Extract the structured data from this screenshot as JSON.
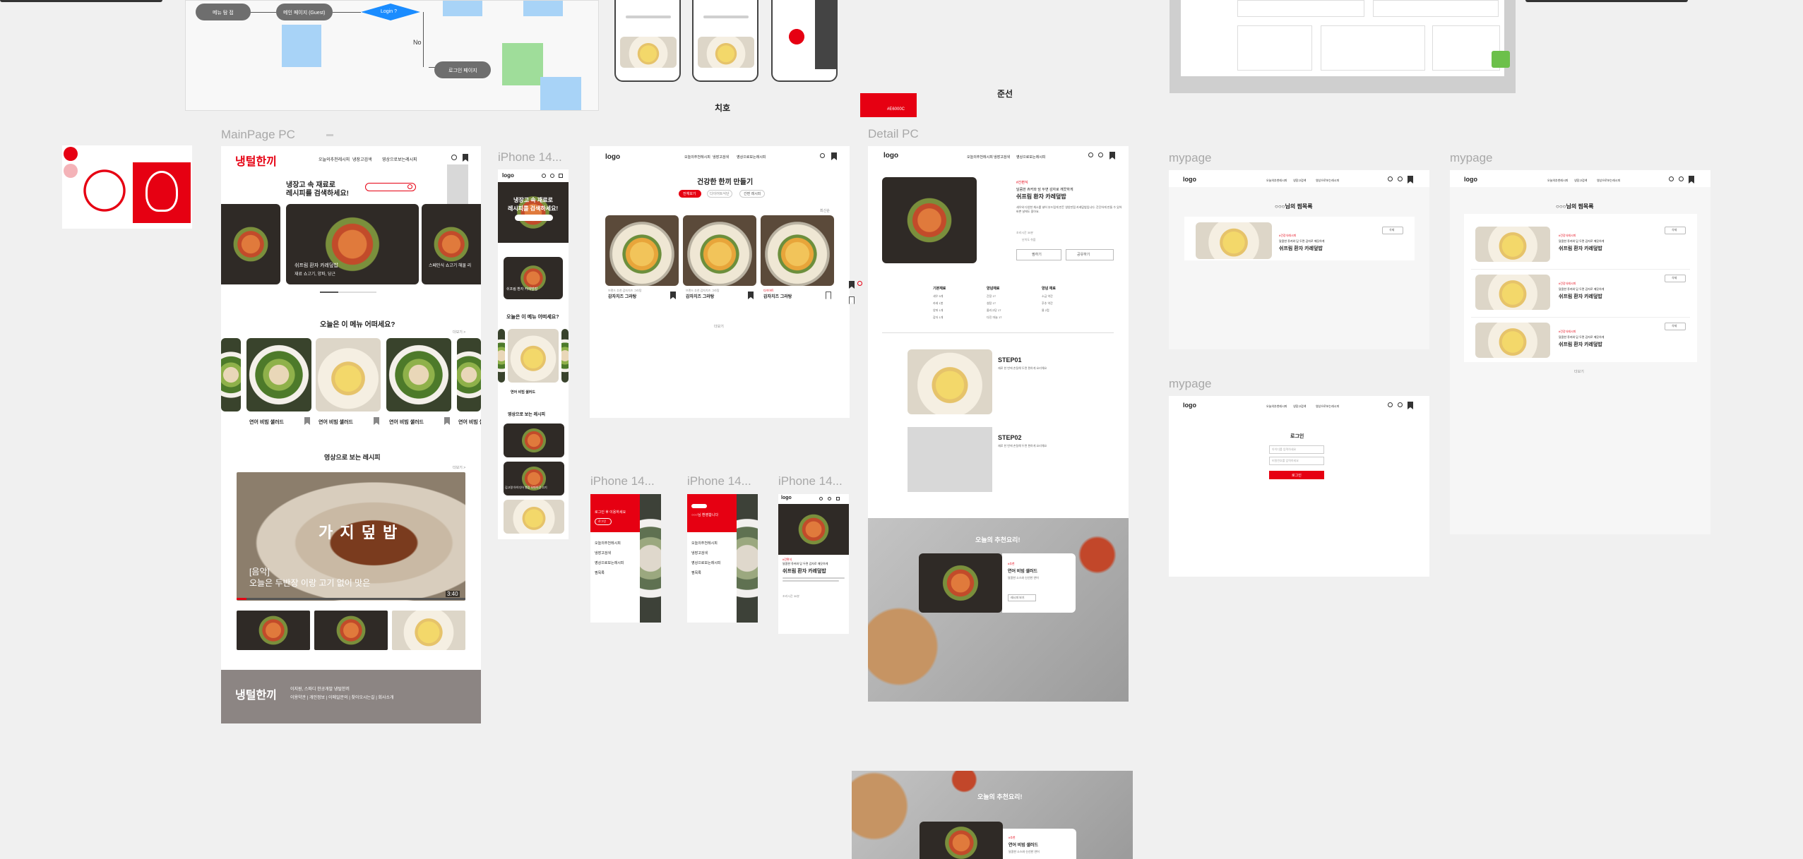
{
  "frame_labels": {
    "main_pc": "MainPage PC",
    "iphone_main": "iPhone 14...",
    "detail_pc": "Detail PC",
    "mypage1": "mypage",
    "mypage2": "mypage",
    "mypage3": "mypage",
    "iphone_a": "iPhone 14...",
    "iphone_b": "iPhone 14...",
    "iphone_c": "iPhone 14..."
  },
  "flow": {
    "node1": "메뉴 탐 접",
    "node2": "메인 페이지 (Guest)",
    "decision": "Login ?",
    "no_label": "No",
    "login_node": "로그인 페이지"
  },
  "captions": {
    "chiho": "치호",
    "junseon": "준선",
    "red_swatch": "#E6000C"
  },
  "colors": {
    "accent": "#e60012",
    "footer": "#8c8583",
    "flow_blue": "#1a8cff",
    "sticky_blue": "#a8d3f7",
    "sticky_green": "#9fdd9a",
    "green_badge": "#6cc04a"
  },
  "main_pc": {
    "nav": [
      "오늘의추천레시피",
      "냉장고검색",
      "영상으로보는레시피"
    ],
    "hero_title_1": "냉장고 속 재료로",
    "hero_title_2": "레시피를 검색하세요!",
    "hero_card_title": "쉬프림 환자 카레덮밥",
    "hero_card_sub": "재료 쇼고기, 양파, 당근",
    "hero_card_right": "스페인식 쇼고기 해물 리",
    "section_today": "오늘은 이 메뉴 어떠세요?",
    "more": "더보기 >",
    "today_items": [
      "연어 비빔 샐러드",
      "연어 비빔 샐러드",
      "연어 비빔 샐러드",
      "연어 비빔 샐"
    ],
    "section_video": "영상으로 보는 레시피",
    "video_overlay": "가 지 덮 밥",
    "video_caption_1": "[음악]",
    "video_caption_2": "오늘은 두반장 이랑 고기 없이 맛은",
    "video_time": "3:40",
    "footer_text": "이지원, 스파디 한공개발 냉털한끼",
    "footer_links": "이용약관 | 개인정보 | 이메일문의 | 찾아오시는길 | 회사소개",
    "logo_text": "냉털한끼"
  },
  "iphone_main": {
    "logo": "logo",
    "hero_1": "냉장고 속 재료로",
    "hero_2": "레시피를 검색하세요!",
    "card_title": "쉬프림 환자 카레덮밥",
    "section_today": "오늘은 이 메뉴 어떠세요?",
    "today_item": "연어 비빔 샐러드",
    "section_video": "영상으로 보는 레시피",
    "video_cap": "김고명 아이디어 볶음 오마이갓 고기"
  },
  "list_pc": {
    "logo": "logo",
    "nav": [
      "오늘의추천레시피",
      "냉장고검색",
      "영상으로보는레시피"
    ],
    "title": "건강한 한끼 만들기",
    "chips": [
      "전체보기",
      "다이어트식단",
      "간편 레시피"
    ],
    "cards": [
      {
        "label": "브랜드 추천 감자치즈 그라탕",
        "title": "감자치즈 그라탕"
      },
      {
        "label": "브랜드 추천 감자치즈 그라탕",
        "title": "감자치즈 그라탕"
      },
      {
        "label": "다이어트",
        "title": "감자치즈 그라탕"
      }
    ],
    "sort": "최신순",
    "more": "더보기"
  },
  "detail_pc": {
    "logo": "logo",
    "nav": [
      "오늘의추천레시피",
      "냉장고검색",
      "영상으로보는레시피"
    ],
    "badge": "#간편식",
    "desc": "달콤한 쥬커와 담 두면 감자로 깨끗하게",
    "title": "쉬프림 환자 카레덮밥",
    "paragraph": "새우와 다양한 채소를 넣어 부드럽게 만든 영양만점 카레덮밥입니다. 간단하게 만들 수 있어 바쁜 날에도 좋아요.",
    "meta1": "조리시간 30분",
    "meta2": "난이도 쉬움",
    "btn_left": "찜하기",
    "btn_right": "공유하기",
    "col1_title": "기본재료",
    "col2_title": "양념재료",
    "col3_title": "양념 재료",
    "col1_items": [
      "새우 5개",
      "카레 1봉",
      "양파 1개",
      "감자 1개"
    ],
    "col2_items": [
      "간장 1T",
      "설탕 1T",
      "올리고당 1T",
      "다진 마늘 1T"
    ],
    "col3_items": [
      "소금 약간",
      "후추 약간",
      "물 2컵"
    ],
    "step1": "STEP01",
    "step1_text": "재료 한 번에 손질해 두면 편하게 요리해요",
    "step2": "STEP02",
    "step2_text": "재료 한 번에 손질해 두면 편하게 요리해요",
    "reco_title": "오늘의 추천요리!",
    "reco_tag": "#추천",
    "reco_name": "연어 비빔 샐러드",
    "reco_desc": "달콤한 소스와 신선한 연어",
    "reco_btn": "레시피 보기"
  },
  "bottom": {
    "reco_title": "오늘의 추천요리!",
    "reco_tag": "#추천",
    "reco_name": "연어 비빔 샐러드",
    "reco_desc": "달콤한 소스와 신선한 연어"
  },
  "mypage1": {
    "logo": "logo",
    "nav": [
      "오늘의추천레시피",
      "냉장고검색",
      "영상으로보는레시피"
    ],
    "title": "○○○님의 찜목록",
    "tag": "#건강식레시피",
    "desc": "달콤한 쥬커와 담 두면 감자로 깨끗하게",
    "name": "쉬프림 환자 카레덮밥",
    "btn": "삭제"
  },
  "mypage2": {
    "logo": "logo",
    "nav": [
      "오늘의추천레시피",
      "냉장고검색",
      "영상으로보는레시피"
    ],
    "title": "○○○님의 찜목록",
    "items": [
      {
        "tag": "#건강식레시피",
        "desc": "달콤한 쥬커와 담 두면 감자로 깨끗하게",
        "name": "쉬프림 환자 카레덮밥"
      },
      {
        "tag": "#건강식레시피",
        "desc": "달콤한 쥬커와 담 두면 감자로 깨끗하게",
        "name": "쉬프림 환자 카레덮밥"
      },
      {
        "tag": "#건강식레시피",
        "desc": "달콤한 쥬커와 담 두면 감자로 깨끗하게",
        "name": "쉬프림 환자 카레덮밥"
      }
    ],
    "btn": "삭제",
    "more": "더보기"
  },
  "mypage3": {
    "logo": "logo",
    "nav": [
      "오늘의추천레시피",
      "냉장고검색",
      "영상으로보는레시피"
    ],
    "title": "로그인",
    "id_ph": "아이디를 입력하세요",
    "pw_ph": "비밀번호를 입력하세요",
    "btn": "로그인"
  },
  "iphone_menu": {
    "welcome_a": "로그인 후 이용하세요",
    "login_btn": "로그인",
    "menu_a": [
      "오늘의추천레시피",
      "냉장고검색",
      "영상으로보는레시피",
      "찜목록"
    ],
    "welcome_b": "○○○님 환영합니다",
    "menu_b": [
      "오늘의추천레시피",
      "냉장고검색",
      "영상으로보는레시피",
      "찜목록"
    ],
    "logo_c": "logo",
    "tag_c": "#간편식",
    "desc_c": "달콤한 쥬커와 담 두면 감자로 깨끗하게",
    "title_c": "쉬프림 환자 카레덮밥",
    "meta_c": "조리시간 30분"
  }
}
